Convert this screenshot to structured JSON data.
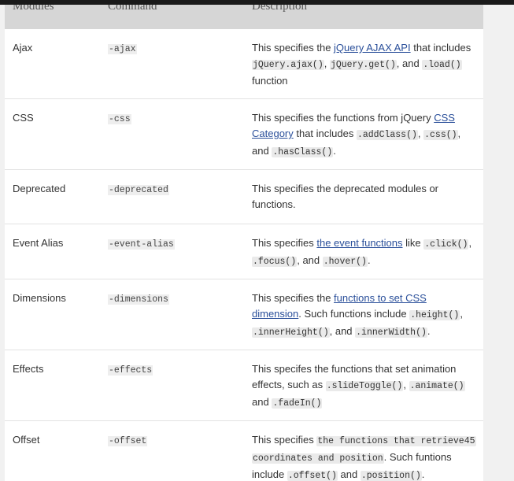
{
  "headers": {
    "modules": "Modules",
    "command": "Command",
    "description": "Description"
  },
  "rows": [
    {
      "module": "Ajax",
      "command": "-ajax",
      "d": [
        "This specifies the ",
        "jQuery AJAX API",
        " that includes",
        "jQuery.ajax()",
        ", ",
        "jQuery.get()",
        ", and ",
        ".load()",
        "function"
      ]
    },
    {
      "module": "CSS",
      "command": "-css",
      "d": [
        "This specifies the functions from jQuery ",
        "CSS",
        "Category",
        " that includes ",
        ".addClass()",
        ", ",
        ".css()",
        ",",
        "and ",
        ".hasClass()",
        "."
      ]
    },
    {
      "module": "Deprecated",
      "command": "-deprecated",
      "d": [
        "This specifies the deprecated modules or",
        "functions."
      ]
    },
    {
      "module": "Event Alias",
      "command": "-event-alias",
      "d": [
        "This specifies ",
        "the event functions",
        " like ",
        ".click()",
        ",",
        ".focus()",
        ", and ",
        ".hover()",
        "."
      ]
    },
    {
      "module": "Dimensions",
      "command": "-dimensions",
      "d": [
        "This specifies the ",
        "functions to set CSS",
        "dimension",
        ". Such functions include ",
        ".height()",
        ",",
        ".innerHeight()",
        ", and ",
        ".innerWidth()",
        "."
      ]
    },
    {
      "module": "Effects",
      "command": "-effects",
      "d": [
        "This specifes the functions that set animation",
        "effects, such as ",
        ".slideToggle()",
        ", ",
        ".animate()",
        "and ",
        ".fadeIn()"
      ]
    },
    {
      "module": "Offset",
      "command": "-offset",
      "d": [
        "This specifies ",
        "the functions that retrieve45",
        "coordinates and position",
        ". Such funtions",
        "include ",
        ".offset()",
        " and ",
        ".position()",
        "."
      ]
    }
  ]
}
